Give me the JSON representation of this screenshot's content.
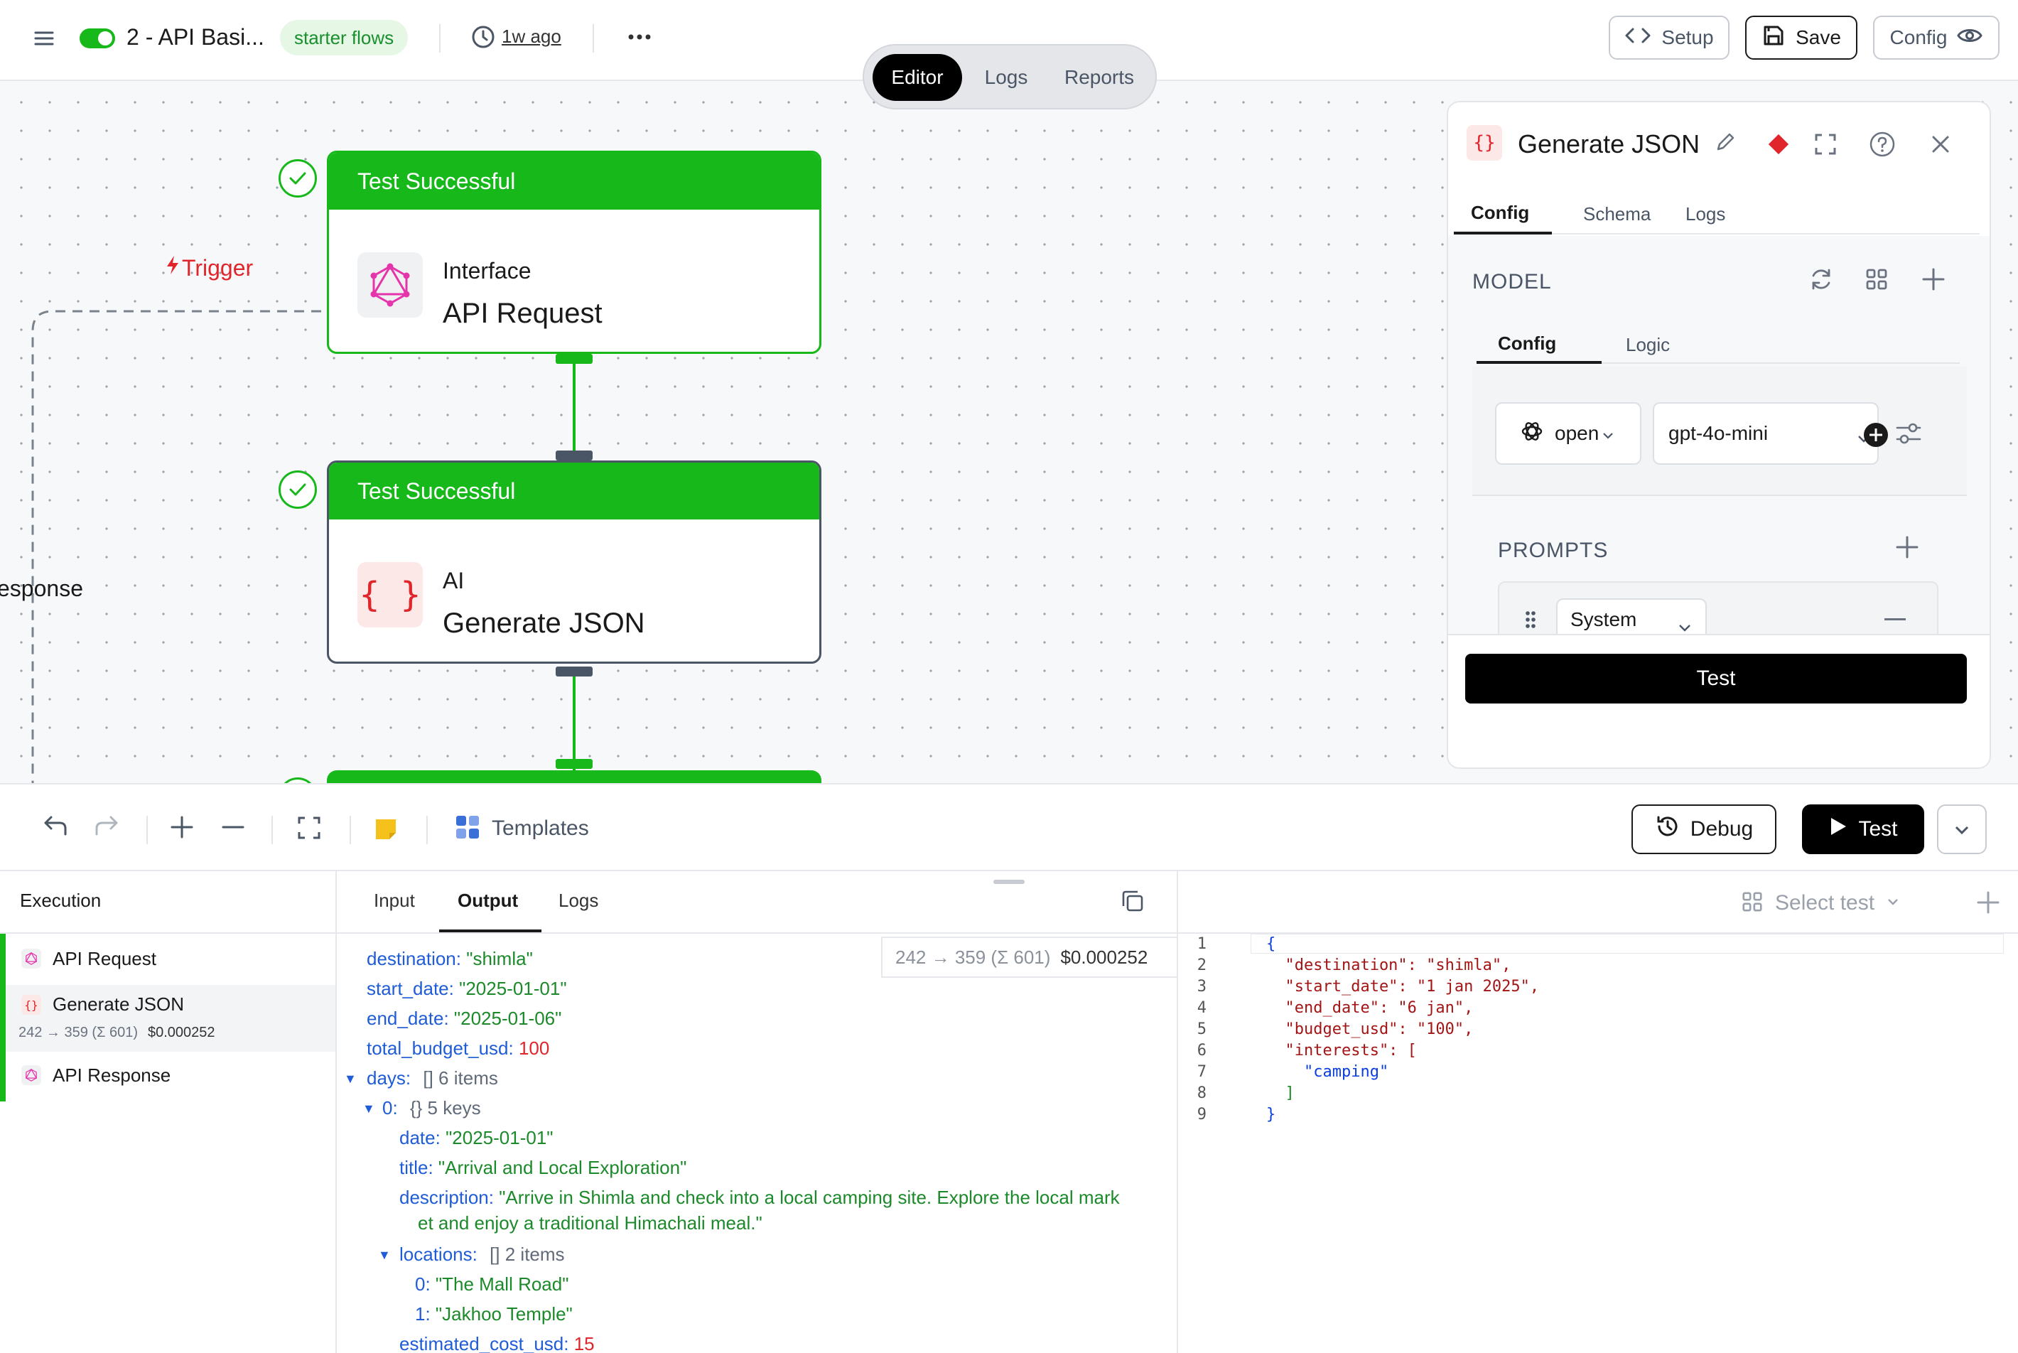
{
  "header": {
    "flow_title": "2 - API Basi...",
    "tag": "starter flows",
    "last_edited": "1w ago",
    "setup_label": "Setup",
    "save_label": "Save",
    "config_label": "Config"
  },
  "mode_tabs": [
    "Editor",
    "Logs",
    "Reports"
  ],
  "canvas": {
    "trigger_label": "Trigger",
    "edge_label": "esponse",
    "nodes": [
      {
        "status": "Test Successful",
        "category": "Interface",
        "name": "API Request"
      },
      {
        "status": "Test Successful",
        "category": "AI",
        "name": "Generate JSON"
      }
    ]
  },
  "panel": {
    "title": "Generate JSON",
    "tabs": [
      "Config",
      "Schema",
      "Logs"
    ],
    "model_heading": "MODEL",
    "subtabs": [
      "Config",
      "Logic"
    ],
    "provider": "open",
    "model": "gpt-4o-mini",
    "prompts_heading": "PROMPTS",
    "prompt_role": "System",
    "test_label": "Test"
  },
  "toolbar": {
    "templates_label": "Templates",
    "debug_label": "Debug",
    "test_label": "Test"
  },
  "execution": {
    "heading": "Execution",
    "items": [
      {
        "name": "API Request",
        "meta": ""
      },
      {
        "name": "Generate JSON",
        "tokens": "242 → 359 (Σ 601)",
        "cost": "$0.000252"
      },
      {
        "name": "API Response",
        "meta": ""
      }
    ]
  },
  "output": {
    "tabs": [
      "Input",
      "Output",
      "Logs"
    ],
    "tokens": "242 → 359 (Σ 601)",
    "cost": "$0.000252",
    "rows": {
      "destination_key": "destination:",
      "destination_val": "\"shimla\"",
      "start_key": "start_date:",
      "start_val": "\"2025-01-01\"",
      "end_key": "end_date:",
      "end_val": "\"2025-01-06\"",
      "budget_key": "total_budget_usd:",
      "budget_val": "100",
      "days_key": "days:",
      "days_meta": "[] 6 items",
      "day0_key": "0:",
      "day0_meta": "{} 5 keys",
      "date_key": "date:",
      "date_val": "\"2025-01-01\"",
      "title_key": "title:",
      "title_val": "\"Arrival and Local Exploration\"",
      "desc_key": "description:",
      "desc_val_1": "\"Arrive in Shimla and check into a local camping site. Explore the local mark",
      "desc_val_2": "et and enjoy a traditional Himachali meal.\"",
      "loc_key": "locations:",
      "loc_meta": "[] 2 items",
      "loc0_key": "0:",
      "loc0_val": "\"The Mall Road\"",
      "loc1_key": "1:",
      "loc1_val": "\"Jakhoo Temple\"",
      "cost_key": "estimated_cost_usd:",
      "cost_val": "15"
    }
  },
  "test_input": {
    "select_label": "Select test",
    "lines": [
      "{",
      "  \"destination\": \"shimla\",",
      "  \"start_date\": \"1 jan 2025\",",
      "  \"end_date\": \"6 jan\",",
      "  \"budget_usd\": \"100\",",
      "  \"interests\": [",
      "    \"camping\"",
      "  ]",
      "}"
    ]
  }
}
